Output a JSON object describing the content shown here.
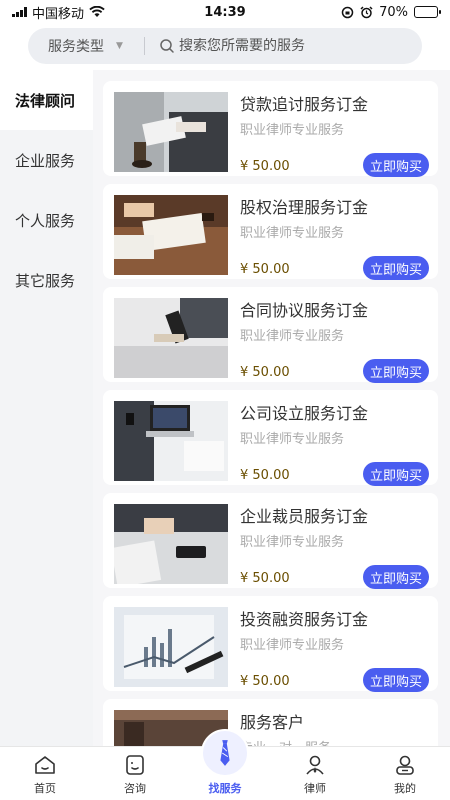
{
  "status_bar": {
    "carrier": "中国移动",
    "time": "14:39",
    "battery": "70%",
    "battery_level": 0.7
  },
  "search": {
    "type_label": "服务类型",
    "placeholder": "搜索您所需要的服务"
  },
  "sidebar": {
    "items": [
      {
        "label": "法律顾问",
        "active": true
      },
      {
        "label": "企业服务",
        "active": false
      },
      {
        "label": "个人服务",
        "active": false
      },
      {
        "label": "其它服务",
        "active": false
      }
    ]
  },
  "services": [
    {
      "title": "贷款追讨服务订金",
      "subtitle": "职业律师专业服务",
      "price": "¥ 50.00",
      "button": "立即购买"
    },
    {
      "title": "股权治理服务订金",
      "subtitle": "职业律师专业服务",
      "price": "¥ 50.00",
      "button": "立即购买"
    },
    {
      "title": "合同协议服务订金",
      "subtitle": "职业律师专业服务",
      "price": "¥ 50.00",
      "button": "立即购买"
    },
    {
      "title": "公司设立服务订金",
      "subtitle": "职业律师专业服务",
      "price": "¥ 50.00",
      "button": "立即购买"
    },
    {
      "title": "企业裁员服务订金",
      "subtitle": "职业律师专业服务",
      "price": "¥ 50.00",
      "button": "立即购买"
    },
    {
      "title": "投资融资服务订金",
      "subtitle": "职业律师专业服务",
      "price": "¥ 50.00",
      "button": "立即购买"
    },
    {
      "title": "服务客户",
      "subtitle": "专业一对一服务",
      "price": "",
      "button": ""
    }
  ],
  "tabs": [
    {
      "label": "首页",
      "icon": "home-icon",
      "active": false
    },
    {
      "label": "咨询",
      "icon": "chat-icon",
      "active": false
    },
    {
      "label": "找服务",
      "icon": "lawyer-tie-icon",
      "active": true
    },
    {
      "label": "律师",
      "icon": "lawyer-icon",
      "active": false
    },
    {
      "label": "我的",
      "icon": "profile-icon",
      "active": false
    }
  ],
  "colors": {
    "accent": "#4a5df0",
    "price": "#6a4e00",
    "sidebar_bg": "#f3f4f6"
  }
}
